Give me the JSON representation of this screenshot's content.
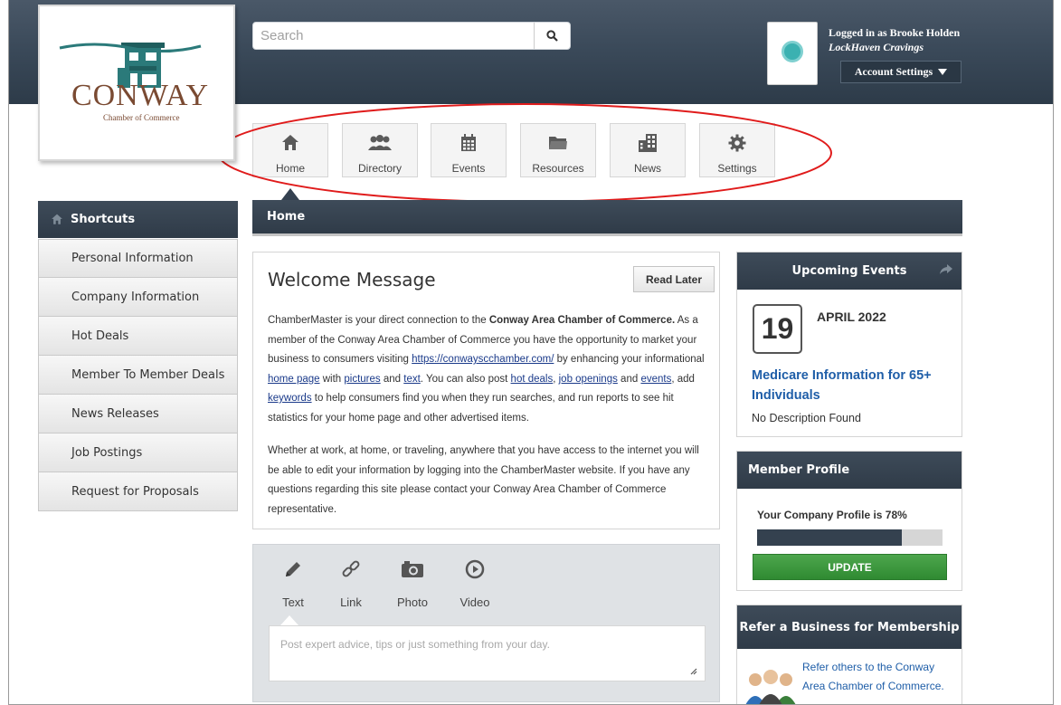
{
  "logo": {
    "name": "CONWAY",
    "subtitle": "Chamber of Commerce"
  },
  "search": {
    "placeholder": "Search",
    "icon": "search-icon"
  },
  "user": {
    "logged_in_text": "Logged in as Brooke Holden",
    "business": "LockHaven Cravings",
    "account_button": "Account Settings"
  },
  "nav": {
    "tabs": [
      {
        "label": "Home",
        "icon": "home-icon"
      },
      {
        "label": "Directory",
        "icon": "users-icon"
      },
      {
        "label": "Events",
        "icon": "calendar-icon"
      },
      {
        "label": "Resources",
        "icon": "folder-icon"
      },
      {
        "label": "News",
        "icon": "buildings-icon"
      },
      {
        "label": "Settings",
        "icon": "gear-icon"
      }
    ],
    "active": "Home"
  },
  "shortcuts": {
    "title": "Shortcuts",
    "items": [
      "Personal Information",
      "Company Information",
      "Hot Deals",
      "Member To Member Deals",
      "News Releases",
      "Job Postings",
      "Request for Proposals"
    ]
  },
  "page_title": "Home",
  "welcome": {
    "title": "Welcome Message",
    "read_later": "Read Later",
    "p1": {
      "t1": "ChamberMaster is your direct connection to the ",
      "org": "Conway Area Chamber of Commerce.",
      "t2": " As a member of the Conway Area Chamber of Commerce you have the opportunity to market your business to consumers visiting ",
      "link_site": "https://conwayscchamber.com/",
      "t3": " by enhancing your informational ",
      "link_home": "home page",
      "t4": " with ",
      "link_pictures": "pictures",
      "t5": " and ",
      "link_text": "text",
      "t6": ". You can also post ",
      "link_hot": "hot deals",
      "t7": ", ",
      "link_jobs": "job openings",
      "t8": " and ",
      "link_events": "events",
      "t9": ", add ",
      "link_keywords": "keywords",
      "t10": " to help consumers find you when they run searches, and run reports to see hit statistics for your home page and other advertised items."
    },
    "p2": "Whether at work, at home, or traveling, anywhere that you have access to the internet you will be able to edit your information by logging into the ChamberMaster website. If you have any questions regarding this site please contact your Conway Area Chamber of Commerce representative."
  },
  "composer": {
    "types": [
      {
        "label": "Text",
        "icon": "pencil-icon"
      },
      {
        "label": "Link",
        "icon": "link-icon"
      },
      {
        "label": "Photo",
        "icon": "camera-icon"
      },
      {
        "label": "Video",
        "icon": "play-icon"
      }
    ],
    "placeholder": "Post expert advice, tips or just something from your day."
  },
  "events": {
    "title": "Upcoming Events",
    "day": "19",
    "month_year": "APRIL 2022",
    "event_title": "Medicare Information for 65+ Individuals",
    "description": "No Description Found"
  },
  "member_profile": {
    "title": "Member Profile",
    "status_text": "Your Company Profile is 78%",
    "progress": 0.78,
    "button": "UPDATE"
  },
  "refer": {
    "title": "Refer a Business for Membership",
    "text": "Refer others to the Conway Area Chamber of Commerce."
  },
  "colors": {
    "header_dark": "#2f3b48",
    "link_blue": "#1f5ea8",
    "update_green": "#3a973d",
    "annotation_red": "#e01b1b",
    "logo_brown": "#7a4a32",
    "logo_teal": "#2b7a7a"
  }
}
